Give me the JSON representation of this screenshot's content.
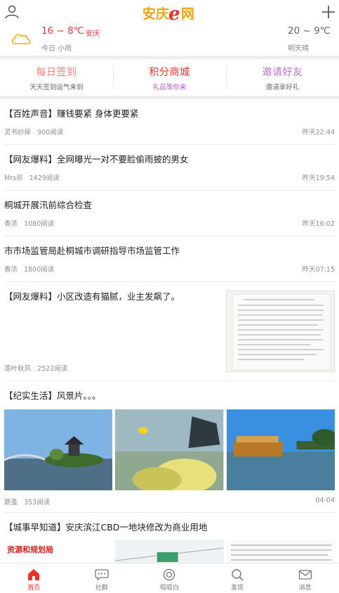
{
  "header": {
    "logo_text": "安庆e网"
  },
  "weather": {
    "today_temp": "16 ~ 8℃",
    "city": "安庆",
    "today_cond": "今日 小雨",
    "tomorrow_temp": "20 ~ 9℃",
    "tomorrow_cond": "明天晴"
  },
  "actions": [
    {
      "title": "每日签到",
      "sub": "天天签到运气来到",
      "color": "#f08080"
    },
    {
      "title": "积分商城",
      "sub": "礼品等你来",
      "color": "#e8322b",
      "sub_color": "#b05bc2"
    },
    {
      "title": "邀请好友",
      "sub": "邀请享好礼",
      "color": "#c86dd7"
    }
  ],
  "feed": [
    {
      "title": "【百姓声音】赚钱要紧 身体更要紧",
      "author": "灵书妙探",
      "reads": "900阅读",
      "time": "昨天22:44"
    },
    {
      "title": "【网友爆料】全网曝光一对不要脸偷雨披的男女",
      "author": "Mrs邓",
      "reads": "1429阅读",
      "time": "昨天19:54"
    },
    {
      "title": "桐城开展汛前综合检查",
      "author": "香浓",
      "reads": "1080阅读",
      "time": "昨天16:02"
    },
    {
      "title": "市市场监管局赴桐城市调研指导市场监管工作",
      "author": "香浓",
      "reads": "1800阅读",
      "time": "昨天07:15"
    },
    {
      "title": "【网友爆料】小区改造有猫腻，业主发飙了。",
      "author": "落叶秋风",
      "reads": "2522阅读",
      "time": ""
    },
    {
      "title": "【纪实生活】风景片。。。",
      "author": "跳蚤",
      "reads": "353阅读",
      "time": "04-04"
    },
    {
      "title": "【城事早知道】安庆滨江CBD一地块修改为商业用地",
      "img_caption": "资源和规划局"
    }
  ],
  "tabs": [
    {
      "label": "首页",
      "icon": "home-icon",
      "active": true
    },
    {
      "label": "社群",
      "icon": "chat-bubble-icon"
    },
    {
      "label": "呱呱白",
      "icon": "target-icon"
    },
    {
      "label": "发现",
      "icon": "search-icon"
    },
    {
      "label": "消息",
      "icon": "mail-icon"
    }
  ]
}
